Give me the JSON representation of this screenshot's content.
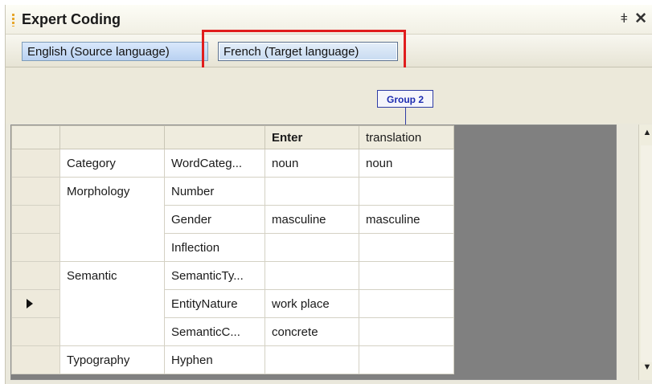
{
  "panel": {
    "title": "Expert Coding",
    "pin_glyph": "ǂ",
    "close_glyph": "✕"
  },
  "tabs": [
    {
      "label": "English (Source language)"
    },
    {
      "label": "French (Target language)"
    }
  ],
  "group": {
    "label": "Group 2"
  },
  "grid": {
    "headers": [
      "",
      "",
      "Enter",
      "translation"
    ],
    "rows": [
      {
        "category": "Category",
        "attribute": "WordCateg...",
        "enter": "noun",
        "translation": "noun"
      },
      {
        "category": "Morphology",
        "attribute": "Number",
        "enter": "",
        "translation": ""
      },
      {
        "category": "",
        "attribute": "Gender",
        "enter": "masculine",
        "translation": "masculine"
      },
      {
        "category": "",
        "attribute": "Inflection",
        "enter": "",
        "translation": ""
      },
      {
        "category": "Semantic",
        "attribute": "SemanticTy...",
        "enter": "",
        "translation": ""
      },
      {
        "category": "",
        "attribute": "EntityNature",
        "enter": "work place",
        "translation": ""
      },
      {
        "category": "",
        "attribute": "SemanticC...",
        "enter": "concrete",
        "translation": ""
      },
      {
        "category": "Typography",
        "attribute": "Hyphen",
        "enter": "",
        "translation": ""
      }
    ]
  },
  "colors": {
    "highlight": "#e01d1d",
    "group_border": "#2f3da5",
    "grid_empty": "#808080"
  }
}
